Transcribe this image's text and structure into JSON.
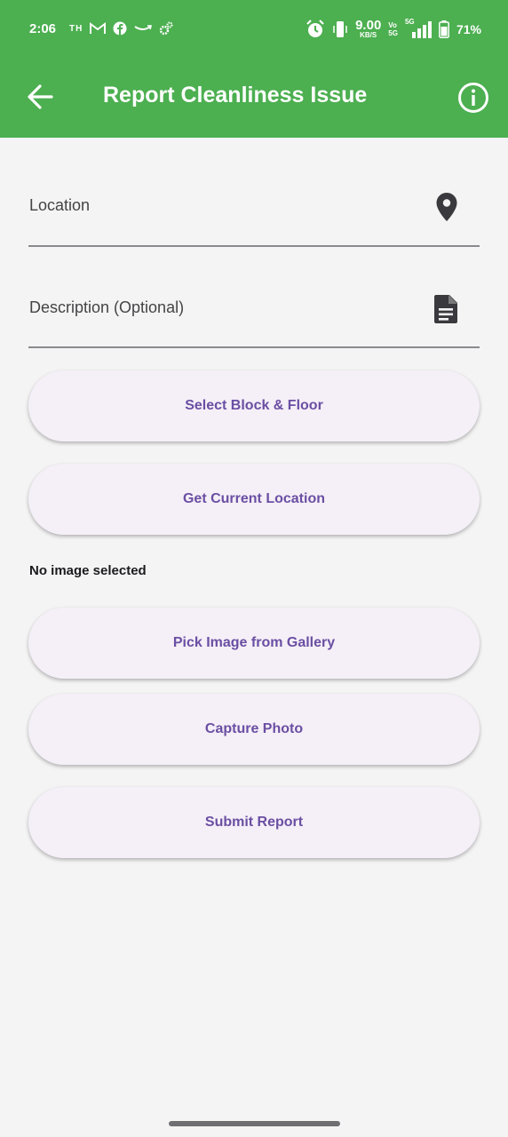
{
  "status_bar": {
    "time": "2:06",
    "carrier_badge": "TH",
    "net_speed_value": "9.00",
    "net_speed_unit": "KB/S",
    "volte_top": "Vo",
    "volte_bottom": "5G",
    "network_type": "5G",
    "battery_percent": "71%"
  },
  "toolbar": {
    "title": "Report Cleanliness Issue",
    "back_icon": "arrow-back-icon",
    "info_icon": "info-icon"
  },
  "form": {
    "location_label": "Location",
    "location_icon": "location-pin-icon",
    "description_label": "Description (Optional)",
    "description_icon": "document-icon",
    "select_block_floor_label": "Select Block & Floor",
    "get_current_location_label": "Get Current Location",
    "image_status": "No image selected",
    "pick_image_label": "Pick Image from Gallery",
    "capture_photo_label": "Capture Photo",
    "submit_label": "Submit Report"
  },
  "colors": {
    "app_bar": "#4caf50",
    "background": "#f4f4f4",
    "button_bg": "#f5eff7",
    "button_text": "#6a4fa3"
  }
}
